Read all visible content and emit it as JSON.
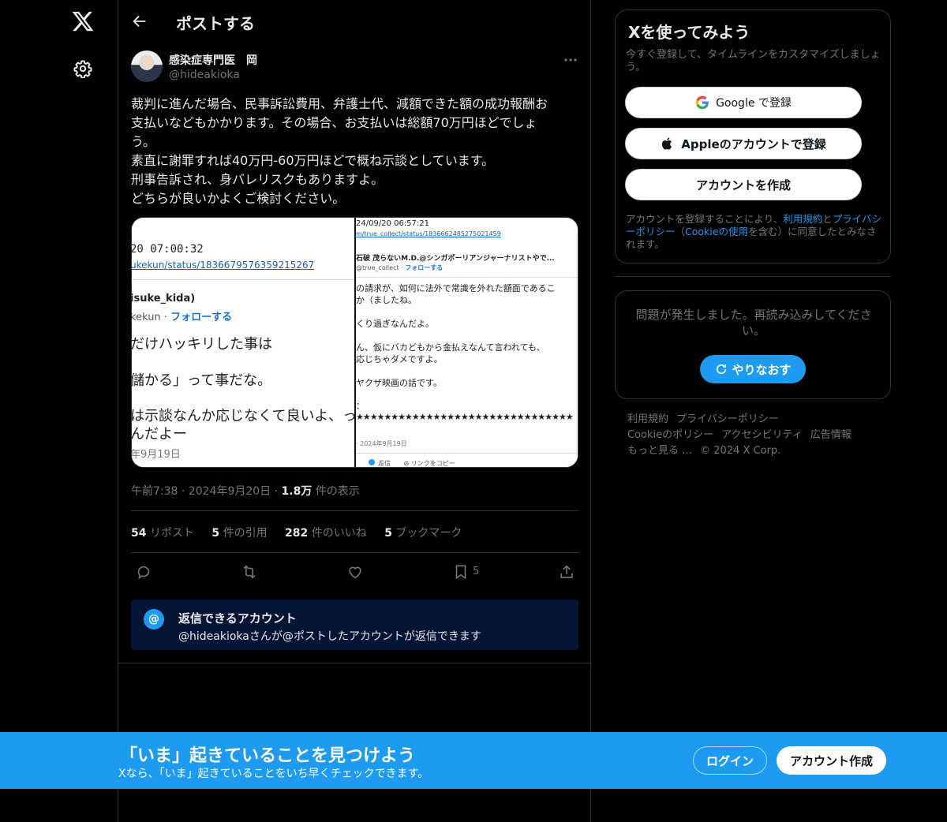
{
  "colors": {
    "accent": "#1d9bf0",
    "background": "#000000",
    "text": "#e7e9ea",
    "muted": "#71767b",
    "border": "#2f3336"
  },
  "nav": {
    "logo_icon": "x-logo-icon",
    "settings_icon": "gear-icon"
  },
  "header": {
    "title": "ポストする",
    "back_icon": "arrow-left-icon"
  },
  "author": {
    "name": "感染症専門医　岡",
    "handle": "@hideakioka"
  },
  "tweet": {
    "lines": [
      "裁判に進んだ場合、民事訴訟費用、弁護士代、減額できた額の成功報酬お",
      "支払いなどもかかります。その場合、お支払いは総額70万円ほどでしょ",
      "う。",
      "素直に謝罪すれば40万円-60万円ほどで概ね示談としています。",
      "刑事告訴され、身バレリスクもありますよ。",
      "どちらが良いかよくご検討ください。"
    ]
  },
  "media": {
    "left": {
      "timestamp": "20 07:00:32",
      "link": "ukekun/status/1836679576359215267",
      "user": "isuke_kida)",
      "follow_prefix": "kekun · ",
      "follow": "フォローする",
      "line1": "だけハッキリした事は",
      "line2": "儲かる」って事だな。",
      "line3": "は示談なんか応じなくて良いよ、っ",
      "line4": "んだよー",
      "date": "年9月19日"
    },
    "right": {
      "timestamp": "24/09/20 06:57:21",
      "link": "m/true_collect/status/1836662485275021459",
      "user": "石破 茂らないM.D.@シンガポーリアンジャーナリストやで...",
      "handle_prefix": "@true_collect · ",
      "follow": "フォローする",
      "line1": "の請求が、如何に法外で常識を外れた額面であるこ",
      "line2": "か（ましたね。",
      "line3": "くり過ぎなんだよ。",
      "line4": "ん、仮にバカどもから金払えなんて言われても、",
      "line5": "応じちゃダメですよ。",
      "line6": "ヤクザ映画の話です。",
      "line7": "：",
      "stars": "★★★★★★★★★★★★★★★★★★★★★★★★★★★★★★★",
      "date": "· 2024年9月19日",
      "reply": "返信",
      "copy": "リンクをコピー"
    }
  },
  "meta": {
    "time": "午前7:38",
    "dot": "·",
    "date": "2024年9月20日",
    "views": "1.8万",
    "views_label": "件の表示"
  },
  "stats": {
    "reposts": "54",
    "reposts_label": "リポスト",
    "quotes": "5",
    "quotes_label": "件の引用",
    "likes": "282",
    "likes_label": "件のいいね",
    "bookmarks": "5",
    "bookmarks_label": "ブックマーク"
  },
  "actions": {
    "bookmark_count": "5"
  },
  "reply_box": {
    "icon": "@",
    "title": "返信できるアカウント",
    "desc": "@hideakiokaさんが@ポストしたアカウントが返信できます"
  },
  "signup": {
    "title": "Xを使ってみよう",
    "subtitle": "今すぐ登録して、タイムラインをカスタマイズしましょう。",
    "google": "Google で登録",
    "apple": "Appleのアカウントで登録",
    "create": "アカウントを作成",
    "terms_pre": "アカウントを登録することにより、",
    "terms_tos": "利用規約",
    "terms_and": "と",
    "terms_privacy": "プライバシーポリシー",
    "terms_mid": "（",
    "terms_cookie": "Cookieの使用",
    "terms_post": "を含む）に同意したとみなされます。"
  },
  "error": {
    "message": "問題が発生しました。再読み込みしてください。",
    "retry": "やりなおす"
  },
  "footer": {
    "tos": "利用規約",
    "privacy": "プライバシーポリシー",
    "cookie": "Cookieのポリシー",
    "accessibility": "アクセシビリティ",
    "ads": "広告情報",
    "more": "もっと見る …",
    "copyright": "© 2024 X Corp."
  },
  "banner": {
    "title": "「いま」起きていることを見つけよう",
    "subtitle": "Xなら、「いま」起きていることをいち早くチェックできます。",
    "login": "ログイン",
    "signup": "アカウント作成"
  }
}
